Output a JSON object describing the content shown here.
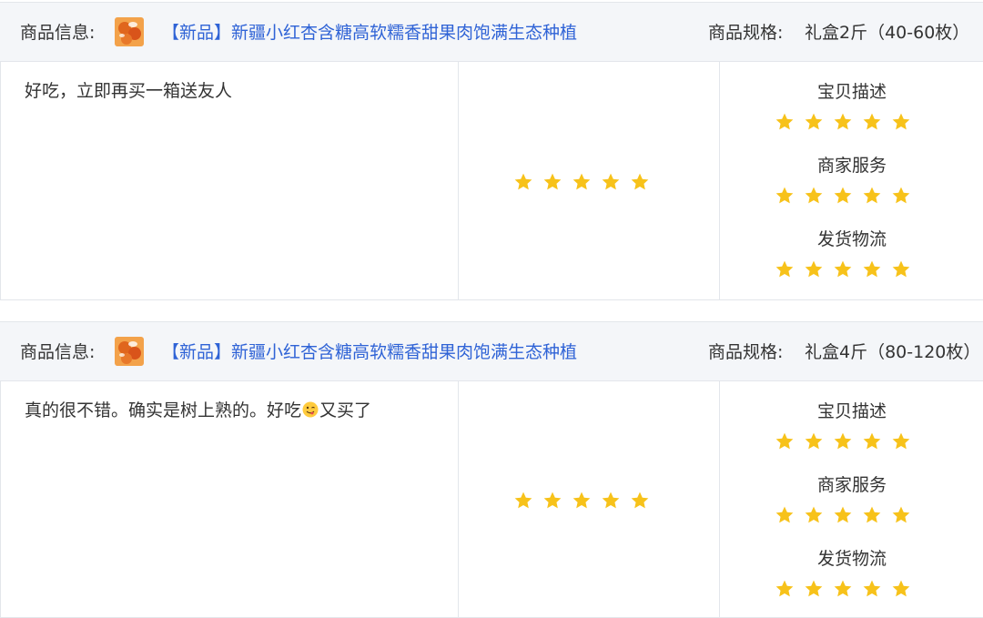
{
  "reviews": [
    {
      "product_info_label": "商品信息:",
      "product_title": "【新品】新疆小红杏含糖高软糯香甜果肉饱满生态种植",
      "spec_label": "商品规格:",
      "spec_value": "礼盒2斤（40-60枚）",
      "comment": "好吃，立即再买一箱送友人",
      "overall_rating": 5,
      "dsr": [
        {
          "label": "宝贝描述",
          "rating": 5
        },
        {
          "label": "商家服务",
          "rating": 5
        },
        {
          "label": "发货物流",
          "rating": 5
        }
      ]
    },
    {
      "product_info_label": "商品信息:",
      "product_title": "【新品】新疆小红杏含糖高软糯香甜果肉饱满生态种植",
      "spec_label": "商品规格:",
      "spec_value": "礼盒4斤（80-120枚）",
      "comment_before_emoji": "真的很不错。确实是树上熟的。好吃",
      "comment_emoji": "yum-face-emoji",
      "comment_after_emoji": "又买了",
      "overall_rating": 5,
      "dsr": [
        {
          "label": "宝贝描述",
          "rating": 5
        },
        {
          "label": "商家服务",
          "rating": 5
        },
        {
          "label": "发货物流",
          "rating": 5
        }
      ]
    }
  ],
  "colors": {
    "star": "#f7c21a",
    "link": "#2f63d6",
    "header_bg": "#f4f6f9",
    "border": "#e3e6eb"
  },
  "icons": {
    "product_thumbnail": "apricot-product-thumbnail",
    "rating_star": "star-icon"
  }
}
